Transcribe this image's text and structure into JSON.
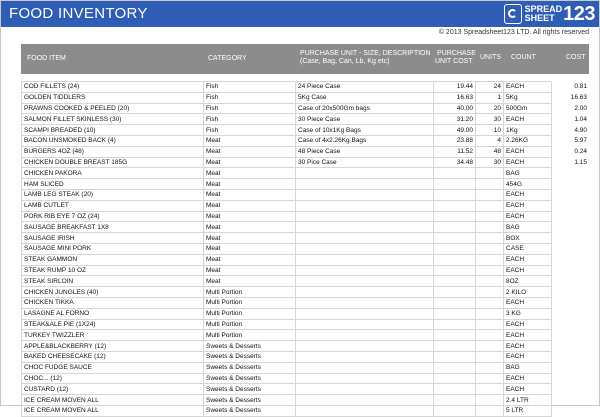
{
  "title": "FOOD INVENTORY",
  "logo": {
    "line1": "SPREAD",
    "line2": "SHEET",
    "num": "123",
    "icon": "spreadsheet123-logo-icon"
  },
  "copyright": "© 2013 Spreadsheet123 LTD. All rights reserved",
  "colors": {
    "title_bar": "#2f5db6",
    "header": "#8c8c8c"
  },
  "headers": {
    "food_item": "FOOD ITEM",
    "category": "CATEGORY",
    "purchase_unit": "PURCHASE UNIT - SIZE, DESCRIPTION",
    "purchase_unit_sub": "(Case, Bag, Can, Lb, Kg etc)",
    "purchase_cost_1": "PURCHASE",
    "purchase_cost_2": "UNIT COST",
    "units": "UNITS",
    "count": "COUNT",
    "cost": "COST"
  },
  "rows": [
    {
      "item": "COD FILLETS (24)",
      "category": "Fish",
      "unit": "24 Piece Case",
      "cost": "19.44",
      "units": "24",
      "count": "EACH",
      "unit_cost": "0.81"
    },
    {
      "item": "GOLDEN TIDDLERS",
      "category": "Fish",
      "unit": "5Kg Case",
      "cost": "16.63",
      "units": "1",
      "count": "5Kg",
      "unit_cost": "16.63"
    },
    {
      "item": "PRAWNS COOKED & PEELED (20)",
      "category": "Fish",
      "unit": "Case of 20x500Gm bags",
      "cost": "40.00",
      "units": "20",
      "count": "500Gm",
      "unit_cost": "2.00"
    },
    {
      "item": "SALMON FILLET SKINLESS (30)",
      "category": "Fish",
      "unit": "30 Piece Case",
      "cost": "31.20",
      "units": "30",
      "count": "EACH",
      "unit_cost": "1.04"
    },
    {
      "item": "SCAMPI BREADED (10)",
      "category": "Fish",
      "unit": "Case of 10x1Kg Bags",
      "cost": "49.00",
      "units": "10",
      "count": "1Kg",
      "unit_cost": "4.90"
    },
    {
      "item": "BACON UNSMOKED BACK (4)",
      "category": "Meat",
      "unit": "Case of 4x2.26Kg Bags",
      "cost": "23.88",
      "units": "4",
      "count": "2.26KG",
      "unit_cost": "5.97"
    },
    {
      "item": "BURGERS 4OZ (48)",
      "category": "Meat",
      "unit": "48 Piece Case",
      "cost": "11.52",
      "units": "48",
      "count": "EACH",
      "unit_cost": "0.24"
    },
    {
      "item": "CHICKEN DOUBLE BREAST 185G",
      "category": "Meat",
      "unit": "30 Pice Case",
      "cost": "34.48",
      "units": "30",
      "count": "EACH",
      "unit_cost": "1.15"
    },
    {
      "item": "CHICKEN PAKORA",
      "category": "Meat",
      "unit": "",
      "cost": "",
      "units": "",
      "count": "BAG",
      "unit_cost": ""
    },
    {
      "item": "HAM SLICED",
      "category": "Meat",
      "unit": "",
      "cost": "",
      "units": "",
      "count": "454G",
      "unit_cost": ""
    },
    {
      "item": "LAMB LEG STEAK (20)",
      "category": "Meat",
      "unit": "",
      "cost": "",
      "units": "",
      "count": "EACH",
      "unit_cost": ""
    },
    {
      "item": "LAMB CUTLET",
      "category": "Meat",
      "unit": "",
      "cost": "",
      "units": "",
      "count": "EACH",
      "unit_cost": ""
    },
    {
      "item": "PORK RIB EYE 7 OZ (24)",
      "category": "Meat",
      "unit": "",
      "cost": "",
      "units": "",
      "count": "EACH",
      "unit_cost": ""
    },
    {
      "item": "SAUSAGE BREAKFAST 1X8",
      "category": "Meat",
      "unit": "",
      "cost": "",
      "units": "",
      "count": "BAG",
      "unit_cost": ""
    },
    {
      "item": "SAUSAGE IRISH",
      "category": "Meat",
      "unit": "",
      "cost": "",
      "units": "",
      "count": "BOX",
      "unit_cost": ""
    },
    {
      "item": "SAUSAGE MINI PORK",
      "category": "Meat",
      "unit": "",
      "cost": "",
      "units": "",
      "count": "CASE",
      "unit_cost": ""
    },
    {
      "item": "STEAK GAMMON",
      "category": "Meat",
      "unit": "",
      "cost": "",
      "units": "",
      "count": "EACH",
      "unit_cost": ""
    },
    {
      "item": "STEAK RUMP 10 OZ",
      "category": "Meat",
      "unit": "",
      "cost": "",
      "units": "",
      "count": "EACH",
      "unit_cost": ""
    },
    {
      "item": "STEAK SIRLOIN",
      "category": "Meat",
      "unit": "",
      "cost": "",
      "units": "",
      "count": "8OZ",
      "unit_cost": ""
    },
    {
      "item": "CHICKEN JUNGLES (40)",
      "category": "Multi Portion",
      "unit": "",
      "cost": "",
      "units": "",
      "count": "2 KILO",
      "unit_cost": ""
    },
    {
      "item": "CHICKEN TIKKA",
      "category": "Multi Portion",
      "unit": "",
      "cost": "",
      "units": "",
      "count": "EACH",
      "unit_cost": ""
    },
    {
      "item": "LASAGNE AL FORNO",
      "category": "Multi Portion",
      "unit": "",
      "cost": "",
      "units": "",
      "count": "3 KG",
      "unit_cost": ""
    },
    {
      "item": "STEAK&ALE PIE (1X24)",
      "category": "Multi Portion",
      "unit": "",
      "cost": "",
      "units": "",
      "count": "EACH",
      "unit_cost": ""
    },
    {
      "item": "TURKEY TWIZZLER",
      "category": "Multi Portion",
      "unit": "",
      "cost": "",
      "units": "",
      "count": "EACH",
      "unit_cost": ""
    },
    {
      "item": "APPLE&BLACKBERRY (12)",
      "category": "Sweets & Desserts",
      "unit": "",
      "cost": "",
      "units": "",
      "count": "EACH",
      "unit_cost": ""
    },
    {
      "item": "BAKED CHEESECAKE (12)",
      "category": "Sweets & Desserts",
      "unit": "",
      "cost": "",
      "units": "",
      "count": "EACH",
      "unit_cost": ""
    },
    {
      "item": "CHOC FUDGE SAUCE",
      "category": "Sweets & Desserts",
      "unit": "",
      "cost": "",
      "units": "",
      "count": "BAG",
      "unit_cost": ""
    },
    {
      "item": "CHOC... (12)",
      "category": "Sweets & Desserts",
      "unit": "",
      "cost": "",
      "units": "",
      "count": "EACH",
      "unit_cost": ""
    },
    {
      "item": "CUSTARD (12)",
      "category": "Sweets & Desserts",
      "unit": "",
      "cost": "",
      "units": "",
      "count": "EACH",
      "unit_cost": ""
    },
    {
      "item": "ICE CREAM MOVEN ALL",
      "category": "Sweets & Desserts",
      "unit": "",
      "cost": "",
      "units": "",
      "count": "2.4 LTR",
      "unit_cost": ""
    },
    {
      "item": "ICE CREAM MOVEN ALL",
      "category": "Sweets & Desserts",
      "unit": "",
      "cost": "",
      "units": "",
      "count": "5 LTR",
      "unit_cost": ""
    }
  ]
}
